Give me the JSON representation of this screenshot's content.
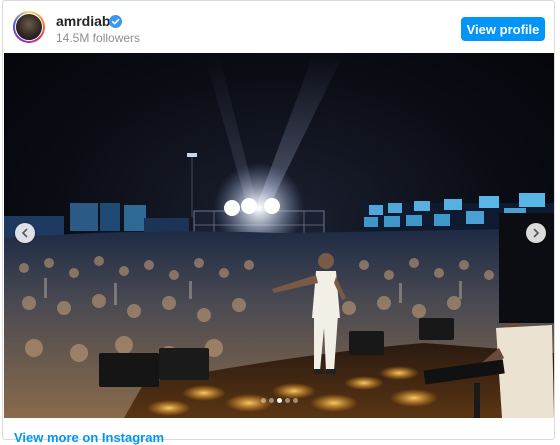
{
  "profile": {
    "username": "amrdiab",
    "followers": "14.5M followers",
    "view_profile_label": "View profile"
  },
  "post": {
    "image_alt": "Concert stage with large crowd at night",
    "carousel_total": 5,
    "carousel_index": 3
  },
  "footer": {
    "link_label": "View more on Instagram"
  },
  "colors": {
    "accent": "#0095f6",
    "verified": "#3897f0",
    "border": "#dbdbdb"
  },
  "icons": {
    "verified": "verified-badge-icon",
    "prev": "chevron-left-icon",
    "next": "chevron-right-icon"
  }
}
